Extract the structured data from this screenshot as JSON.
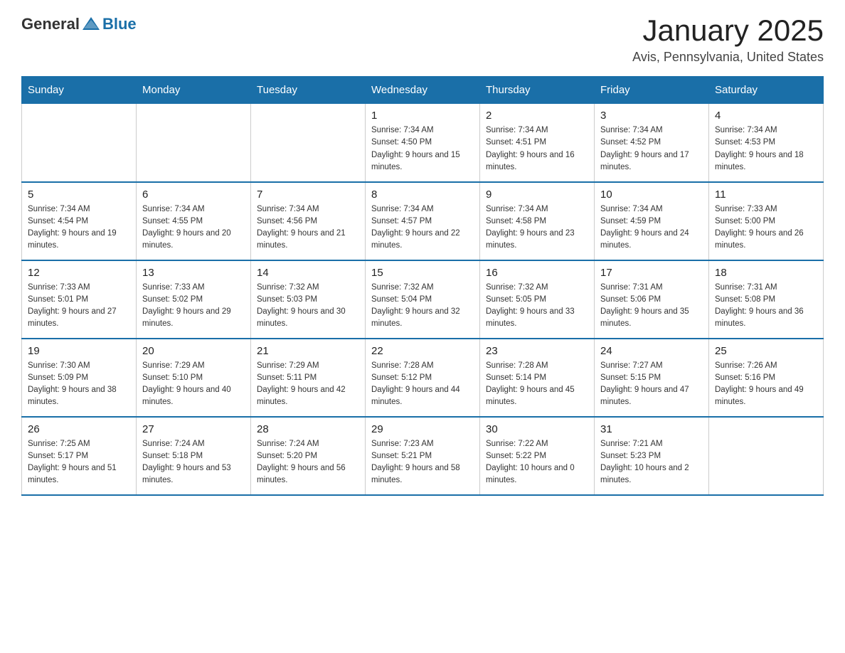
{
  "logo": {
    "general": "General",
    "blue": "Blue"
  },
  "title": "January 2025",
  "subtitle": "Avis, Pennsylvania, United States",
  "days_of_week": [
    "Sunday",
    "Monday",
    "Tuesday",
    "Wednesday",
    "Thursday",
    "Friday",
    "Saturday"
  ],
  "weeks": [
    [
      {
        "day": "",
        "sunrise": "",
        "sunset": "",
        "daylight": ""
      },
      {
        "day": "",
        "sunrise": "",
        "sunset": "",
        "daylight": ""
      },
      {
        "day": "",
        "sunrise": "",
        "sunset": "",
        "daylight": ""
      },
      {
        "day": "1",
        "sunrise": "Sunrise: 7:34 AM",
        "sunset": "Sunset: 4:50 PM",
        "daylight": "Daylight: 9 hours and 15 minutes."
      },
      {
        "day": "2",
        "sunrise": "Sunrise: 7:34 AM",
        "sunset": "Sunset: 4:51 PM",
        "daylight": "Daylight: 9 hours and 16 minutes."
      },
      {
        "day": "3",
        "sunrise": "Sunrise: 7:34 AM",
        "sunset": "Sunset: 4:52 PM",
        "daylight": "Daylight: 9 hours and 17 minutes."
      },
      {
        "day": "4",
        "sunrise": "Sunrise: 7:34 AM",
        "sunset": "Sunset: 4:53 PM",
        "daylight": "Daylight: 9 hours and 18 minutes."
      }
    ],
    [
      {
        "day": "5",
        "sunrise": "Sunrise: 7:34 AM",
        "sunset": "Sunset: 4:54 PM",
        "daylight": "Daylight: 9 hours and 19 minutes."
      },
      {
        "day": "6",
        "sunrise": "Sunrise: 7:34 AM",
        "sunset": "Sunset: 4:55 PM",
        "daylight": "Daylight: 9 hours and 20 minutes."
      },
      {
        "day": "7",
        "sunrise": "Sunrise: 7:34 AM",
        "sunset": "Sunset: 4:56 PM",
        "daylight": "Daylight: 9 hours and 21 minutes."
      },
      {
        "day": "8",
        "sunrise": "Sunrise: 7:34 AM",
        "sunset": "Sunset: 4:57 PM",
        "daylight": "Daylight: 9 hours and 22 minutes."
      },
      {
        "day": "9",
        "sunrise": "Sunrise: 7:34 AM",
        "sunset": "Sunset: 4:58 PM",
        "daylight": "Daylight: 9 hours and 23 minutes."
      },
      {
        "day": "10",
        "sunrise": "Sunrise: 7:34 AM",
        "sunset": "Sunset: 4:59 PM",
        "daylight": "Daylight: 9 hours and 24 minutes."
      },
      {
        "day": "11",
        "sunrise": "Sunrise: 7:33 AM",
        "sunset": "Sunset: 5:00 PM",
        "daylight": "Daylight: 9 hours and 26 minutes."
      }
    ],
    [
      {
        "day": "12",
        "sunrise": "Sunrise: 7:33 AM",
        "sunset": "Sunset: 5:01 PM",
        "daylight": "Daylight: 9 hours and 27 minutes."
      },
      {
        "day": "13",
        "sunrise": "Sunrise: 7:33 AM",
        "sunset": "Sunset: 5:02 PM",
        "daylight": "Daylight: 9 hours and 29 minutes."
      },
      {
        "day": "14",
        "sunrise": "Sunrise: 7:32 AM",
        "sunset": "Sunset: 5:03 PM",
        "daylight": "Daylight: 9 hours and 30 minutes."
      },
      {
        "day": "15",
        "sunrise": "Sunrise: 7:32 AM",
        "sunset": "Sunset: 5:04 PM",
        "daylight": "Daylight: 9 hours and 32 minutes."
      },
      {
        "day": "16",
        "sunrise": "Sunrise: 7:32 AM",
        "sunset": "Sunset: 5:05 PM",
        "daylight": "Daylight: 9 hours and 33 minutes."
      },
      {
        "day": "17",
        "sunrise": "Sunrise: 7:31 AM",
        "sunset": "Sunset: 5:06 PM",
        "daylight": "Daylight: 9 hours and 35 minutes."
      },
      {
        "day": "18",
        "sunrise": "Sunrise: 7:31 AM",
        "sunset": "Sunset: 5:08 PM",
        "daylight": "Daylight: 9 hours and 36 minutes."
      }
    ],
    [
      {
        "day": "19",
        "sunrise": "Sunrise: 7:30 AM",
        "sunset": "Sunset: 5:09 PM",
        "daylight": "Daylight: 9 hours and 38 minutes."
      },
      {
        "day": "20",
        "sunrise": "Sunrise: 7:29 AM",
        "sunset": "Sunset: 5:10 PM",
        "daylight": "Daylight: 9 hours and 40 minutes."
      },
      {
        "day": "21",
        "sunrise": "Sunrise: 7:29 AM",
        "sunset": "Sunset: 5:11 PM",
        "daylight": "Daylight: 9 hours and 42 minutes."
      },
      {
        "day": "22",
        "sunrise": "Sunrise: 7:28 AM",
        "sunset": "Sunset: 5:12 PM",
        "daylight": "Daylight: 9 hours and 44 minutes."
      },
      {
        "day": "23",
        "sunrise": "Sunrise: 7:28 AM",
        "sunset": "Sunset: 5:14 PM",
        "daylight": "Daylight: 9 hours and 45 minutes."
      },
      {
        "day": "24",
        "sunrise": "Sunrise: 7:27 AM",
        "sunset": "Sunset: 5:15 PM",
        "daylight": "Daylight: 9 hours and 47 minutes."
      },
      {
        "day": "25",
        "sunrise": "Sunrise: 7:26 AM",
        "sunset": "Sunset: 5:16 PM",
        "daylight": "Daylight: 9 hours and 49 minutes."
      }
    ],
    [
      {
        "day": "26",
        "sunrise": "Sunrise: 7:25 AM",
        "sunset": "Sunset: 5:17 PM",
        "daylight": "Daylight: 9 hours and 51 minutes."
      },
      {
        "day": "27",
        "sunrise": "Sunrise: 7:24 AM",
        "sunset": "Sunset: 5:18 PM",
        "daylight": "Daylight: 9 hours and 53 minutes."
      },
      {
        "day": "28",
        "sunrise": "Sunrise: 7:24 AM",
        "sunset": "Sunset: 5:20 PM",
        "daylight": "Daylight: 9 hours and 56 minutes."
      },
      {
        "day": "29",
        "sunrise": "Sunrise: 7:23 AM",
        "sunset": "Sunset: 5:21 PM",
        "daylight": "Daylight: 9 hours and 58 minutes."
      },
      {
        "day": "30",
        "sunrise": "Sunrise: 7:22 AM",
        "sunset": "Sunset: 5:22 PM",
        "daylight": "Daylight: 10 hours and 0 minutes."
      },
      {
        "day": "31",
        "sunrise": "Sunrise: 7:21 AM",
        "sunset": "Sunset: 5:23 PM",
        "daylight": "Daylight: 10 hours and 2 minutes."
      },
      {
        "day": "",
        "sunrise": "",
        "sunset": "",
        "daylight": ""
      }
    ]
  ]
}
